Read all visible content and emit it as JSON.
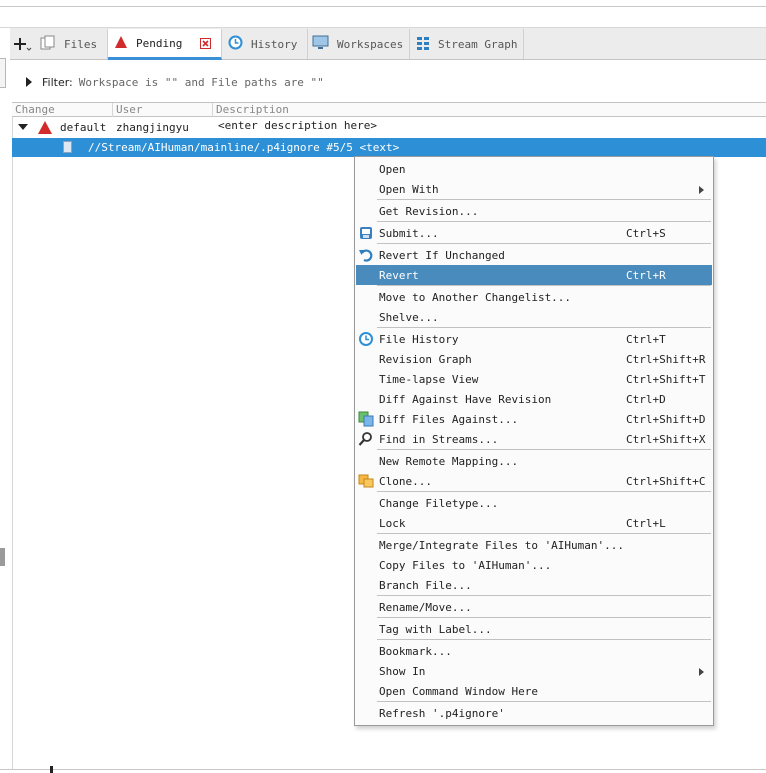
{
  "tabs": [
    {
      "label": "Files",
      "icon": "files-icon"
    },
    {
      "label": "Pending",
      "icon": "pending-changelist-icon",
      "active": true
    },
    {
      "label": "History",
      "icon": "history-clock-icon"
    },
    {
      "label": "Workspaces",
      "icon": "workspace-monitor-icon"
    },
    {
      "label": "Stream Graph",
      "icon": "stream-graph-icon"
    }
  ],
  "filter": {
    "label": "Filter:",
    "text": "Workspace is \"\" and File paths are \"\""
  },
  "columns": {
    "change": "Change",
    "user": "User",
    "description": "Description"
  },
  "changelist": {
    "change": "default",
    "user": "zhangjingyu",
    "description": "<enter description here>"
  },
  "file_row": {
    "path": "//Stream/AIHuman/mainline/.p4ignore #5/5 <text>"
  },
  "context_menu": {
    "items": [
      {
        "label": "Open",
        "shortcut": ""
      },
      {
        "label": "Open With",
        "shortcut": "",
        "submenu": true
      },
      {
        "label": "Get Revision...",
        "shortcut": ""
      },
      {
        "label": "Submit...",
        "shortcut": "Ctrl+S",
        "icon": "submit-icon"
      },
      {
        "label": "Revert If Unchanged",
        "shortcut": "",
        "icon": "revert-arrow-icon"
      },
      {
        "label": "Revert",
        "shortcut": "Ctrl+R",
        "highlighted": true
      },
      {
        "label": "Move to Another Changelist...",
        "shortcut": ""
      },
      {
        "label": "Shelve...",
        "shortcut": ""
      },
      {
        "label": "File History",
        "shortcut": "Ctrl+T",
        "icon": "history-clock-icon"
      },
      {
        "label": "Revision Graph",
        "shortcut": "Ctrl+Shift+R"
      },
      {
        "label": "Time-lapse View",
        "shortcut": "Ctrl+Shift+T"
      },
      {
        "label": "Diff Against Have Revision",
        "shortcut": "Ctrl+D"
      },
      {
        "label": "Diff Files Against...",
        "shortcut": "Ctrl+Shift+D",
        "icon": "diff-files-icon"
      },
      {
        "label": "Find in Streams...",
        "shortcut": "Ctrl+Shift+X",
        "icon": "find-magnifier-icon"
      },
      {
        "label": "New Remote Mapping...",
        "shortcut": ""
      },
      {
        "label": "Clone...",
        "shortcut": "Ctrl+Shift+C",
        "icon": "clone-icon"
      },
      {
        "label": "Change Filetype...",
        "shortcut": ""
      },
      {
        "label": "Lock",
        "shortcut": "Ctrl+L"
      },
      {
        "label": "Merge/Integrate Files to 'AIHuman'...",
        "shortcut": ""
      },
      {
        "label": "Copy Files to 'AIHuman'...",
        "shortcut": ""
      },
      {
        "label": "Branch File...",
        "shortcut": ""
      },
      {
        "label": "Rename/Move...",
        "shortcut": ""
      },
      {
        "label": "Tag with Label...",
        "shortcut": ""
      },
      {
        "label": "Bookmark...",
        "shortcut": ""
      },
      {
        "label": "Show In",
        "shortcut": "",
        "submenu": true
      },
      {
        "label": "Open Command Window Here",
        "shortcut": ""
      },
      {
        "label": "Refresh '.p4ignore'",
        "shortcut": ""
      }
    ]
  },
  "colors": {
    "selection_blue": "#2d8fd6",
    "menu_highlight": "#4a8bbd",
    "pending_red": "#d22b2b",
    "tab_underline": "#3a8fd6"
  }
}
